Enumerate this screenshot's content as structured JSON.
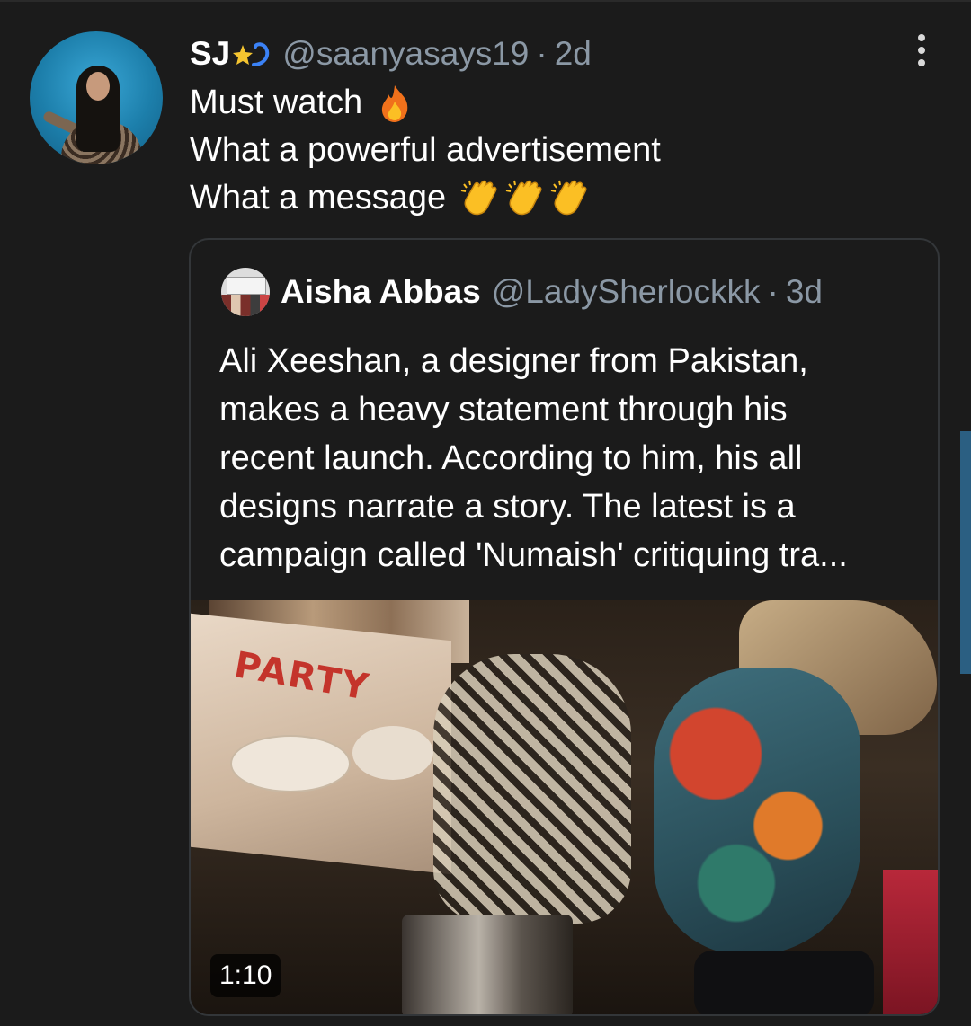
{
  "tweet": {
    "author_name": "SJ",
    "author_handle": "@saanyasays19",
    "separator": "·",
    "time": "2d",
    "lines": [
      "Must watch",
      "What a powerful advertisement",
      "What a message"
    ],
    "emojis": [
      "fire",
      "clapping-hands",
      "clapping-hands",
      "clapping-hands"
    ]
  },
  "quote": {
    "author_name": "Aisha Abbas",
    "author_handle": "@LadySherlockkk",
    "separator": "·",
    "time": "3d",
    "text_lines": [
      "Ali Xeeshan, a designer from Pakistan,",
      "makes a heavy statement through his",
      "recent launch. According to him, his all",
      "designs narrate a story. The latest is a",
      "campaign called 'Numaish' critiquing tra..."
    ],
    "media": {
      "duration": "1:10",
      "package_label": "PARTY"
    }
  },
  "colors": {
    "background": "#1b1b1b",
    "text": "#ffffff",
    "secondary_text": "#8b98a5",
    "border": "#333639",
    "scrollbar": "#2b5f82"
  }
}
